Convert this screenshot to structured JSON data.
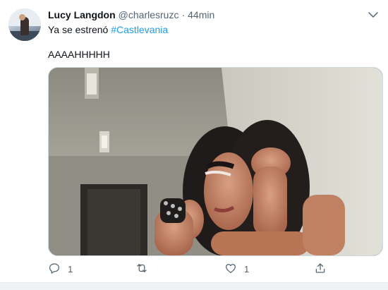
{
  "tweet": {
    "author_name": "Lucy Langdon",
    "handle": "@charlesruzc",
    "separator": "·",
    "time": "44min",
    "text_prefix": "Ya se estrenó ",
    "hashtag": "#Castlevania",
    "text_line2": "AAAAHHHHH"
  },
  "actions": {
    "reply_count": "1",
    "retweet_count": "",
    "like_count": "1"
  },
  "colors": {
    "accent": "#1d9bf0",
    "muted": "#536471"
  },
  "icons": {
    "caret": "chevron-down-icon",
    "reply": "reply-icon",
    "retweet": "retweet-icon",
    "like": "heart-icon",
    "share": "share-icon"
  }
}
